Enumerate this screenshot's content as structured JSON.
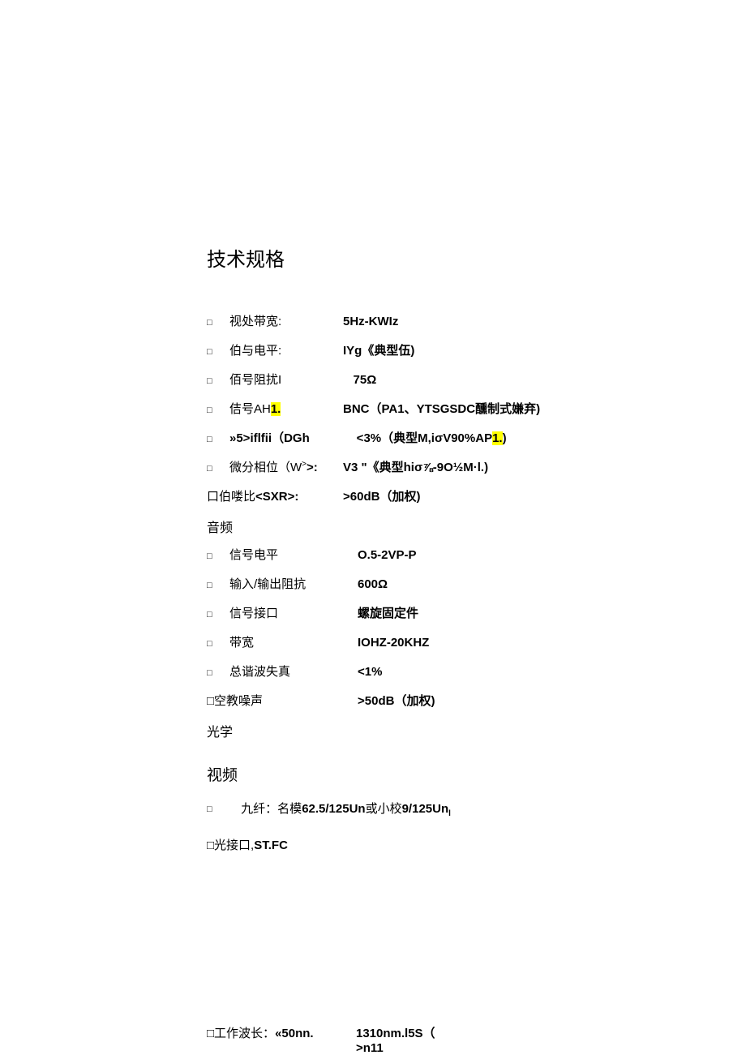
{
  "title": "技术规格",
  "video_specs": [
    {
      "bullet": "□",
      "label": "视处带宽:",
      "value": "5Hz-KWIz"
    },
    {
      "bullet": "□",
      "label": "伯与电平:",
      "value": "IYg《典型伍)"
    },
    {
      "bullet": "□",
      "label": "佰号阻扰I",
      "value_prefix": "   ",
      "value": "75Ω"
    },
    {
      "bullet": "□",
      "label_pre": "佶号AH",
      "label_hl": "1.",
      "value": "BNC（PA1、YTSGSDC醺制式嫌弃)"
    },
    {
      "bullet": "□",
      "label": "»5>iflfii（DGh",
      "value_pre": "   <3%（典型M,iσV90%AP",
      "value_hl": "1.",
      "value_post": ")"
    },
    {
      "bullet": "□",
      "label_rich": true,
      "label_pre2": "微分相位（W",
      "label_sup": ">",
      "label_post2": ">:",
      "value": "V3 \"《典型hiσ⅞-9O½M·l.)"
    }
  ],
  "sxr": {
    "label": "口伯喽比<SXR>:",
    "value": ">60dB（加权)"
  },
  "audio_head": "音频",
  "audio_specs": [
    {
      "bullet": "□",
      "label": "信号电平",
      "value": "O.5-2VP-P"
    },
    {
      "bullet": "□",
      "label": "输入/输出阻抗",
      "value": "600Ω"
    },
    {
      "bullet": "□",
      "label": "信号接口",
      "value": "螺旋固定件"
    },
    {
      "bullet": "□",
      "label": "带宽",
      "value": "IOHZ-20KHZ"
    },
    {
      "bullet": "□",
      "label": "总谐波失真",
      "value": "<1%"
    }
  ],
  "noise": {
    "label": "□空教噪声",
    "value": ">50dB（加权)"
  },
  "optics_head": "光学",
  "video_head": "视频",
  "fiber": {
    "bullet": "□",
    "pre": "九纤：名模",
    "bold1": "62.5/125Un",
    "mid": "或小校",
    "bold2": "9/125Un",
    "sub": "l"
  },
  "interface": {
    "label": "□光接口,",
    "value": "ST.FC"
  },
  "footer": {
    "label": "□工作波长：",
    "bold": "«50nn.",
    "line1": "1310nm.l5S（",
    "line2": ">n11"
  }
}
